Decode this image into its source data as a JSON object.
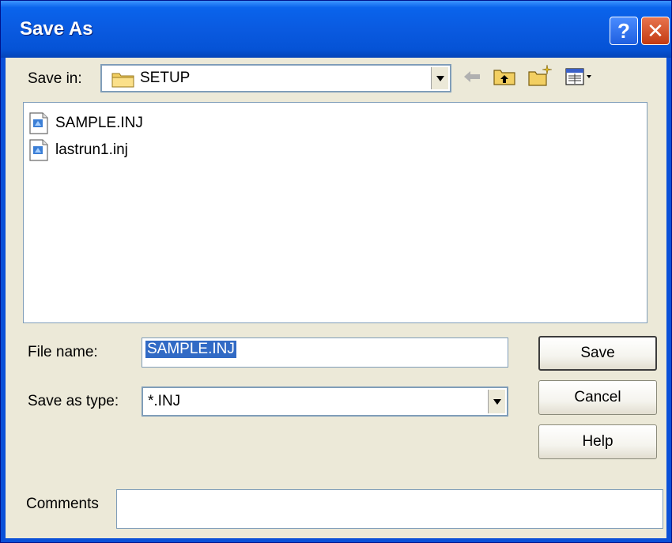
{
  "window": {
    "title": "Save As"
  },
  "titlebar": {
    "help_glyph": "?",
    "close_glyph": "✕"
  },
  "save_in": {
    "label": "Save in:",
    "value": "SETUP"
  },
  "files": [
    {
      "name": "SAMPLE.INJ",
      "icon": "inj-file-icon"
    },
    {
      "name": "lastrun1.inj",
      "icon": "inj-file-icon"
    }
  ],
  "file_name": {
    "label": "File name:",
    "value": "SAMPLE.INJ"
  },
  "save_as_type": {
    "label": "Save as type:",
    "value": "*.INJ"
  },
  "comments": {
    "label": "Comments",
    "value": ""
  },
  "buttons": {
    "save": "Save",
    "cancel": "Cancel",
    "help": "Help"
  },
  "toolbar": {
    "back": "back-icon",
    "up": "up-folder-icon",
    "new_folder": "new-folder-icon",
    "view": "view-menu-icon"
  },
  "colors": {
    "title_blue": "#0a5ae0",
    "client_bg": "#ece9d8",
    "selection": "#316ac5"
  }
}
